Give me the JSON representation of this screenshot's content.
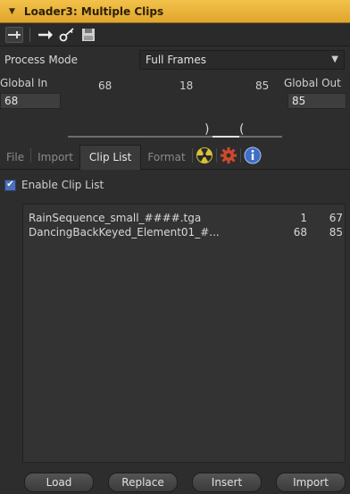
{
  "titlebar": {
    "title": "Loader3: Multiple Clips"
  },
  "toolbar": {
    "icons": [
      "pin-icon",
      "arrow-right-icon",
      "key-icon",
      "save-icon"
    ]
  },
  "process_mode": {
    "label": "Process Mode",
    "value": "Full Frames"
  },
  "global_range": {
    "in_label": "Global In",
    "out_label": "Global Out",
    "in_value": "68",
    "out_value": "85",
    "scale_min": "68",
    "scale_mid": "18",
    "scale_max": "85"
  },
  "tabs": [
    "File",
    "Import",
    "Clip List",
    "Format"
  ],
  "active_tab": "Clip List",
  "enable_clip_list": {
    "label": "Enable Clip List",
    "checked": true
  },
  "clips": [
    {
      "name": "RainSequence_small_####.tga",
      "in": "1",
      "out": "67"
    },
    {
      "name": "DancingBackKeyed_Element01_#...",
      "in": "68",
      "out": "85"
    }
  ],
  "buttons": {
    "load": "Load",
    "replace": "Replace",
    "insert": "Insert",
    "import": "Import"
  },
  "colors": {
    "title_bar": "#e8b33a",
    "checkbox": "#4b6fb8",
    "panel": "#2d2d2d"
  }
}
